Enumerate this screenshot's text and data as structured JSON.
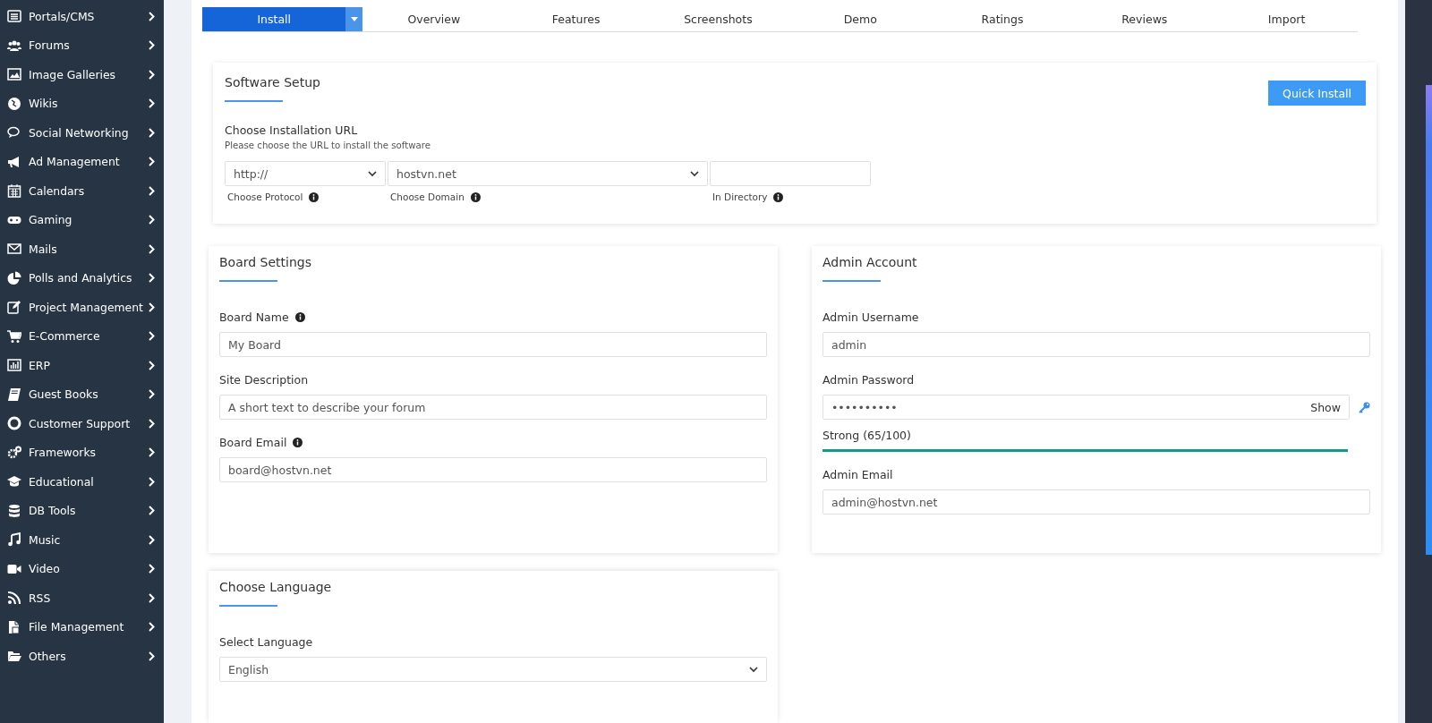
{
  "sidebar": {
    "items": [
      {
        "label": "Portals/CMS"
      },
      {
        "label": "Forums"
      },
      {
        "label": "Image Galleries"
      },
      {
        "label": "Wikis"
      },
      {
        "label": "Social Networking"
      },
      {
        "label": "Ad Management"
      },
      {
        "label": "Calendars"
      },
      {
        "label": "Gaming"
      },
      {
        "label": "Mails"
      },
      {
        "label": "Polls and Analytics"
      },
      {
        "label": "Project Management"
      },
      {
        "label": "E-Commerce"
      },
      {
        "label": "ERP"
      },
      {
        "label": "Guest Books"
      },
      {
        "label": "Customer Support"
      },
      {
        "label": "Frameworks"
      },
      {
        "label": "Educational"
      },
      {
        "label": "DB Tools"
      },
      {
        "label": "Music"
      },
      {
        "label": "Video"
      },
      {
        "label": "RSS"
      },
      {
        "label": "File Management"
      },
      {
        "label": "Others"
      }
    ]
  },
  "tabs": [
    {
      "label": "Install",
      "selected": true,
      "dropdown": true
    },
    {
      "label": "Overview",
      "selected": false,
      "dropdown": false
    },
    {
      "label": "Features",
      "selected": false,
      "dropdown": false
    },
    {
      "label": "Screenshots",
      "selected": false,
      "dropdown": false
    },
    {
      "label": "Demo",
      "selected": false,
      "dropdown": false
    },
    {
      "label": "Ratings",
      "selected": false,
      "dropdown": false
    },
    {
      "label": "Reviews",
      "selected": false,
      "dropdown": false
    },
    {
      "label": "Import",
      "selected": false,
      "dropdown": false
    }
  ],
  "software_setup": {
    "title": "Software Setup",
    "button": "Quick Install",
    "section_label": "Choose Installation URL",
    "hint": "Please choose the URL to install the software",
    "fields": [
      {
        "kind": "select",
        "value": "http://",
        "caption": "Choose Protocol"
      },
      {
        "kind": "select",
        "value": "hostvn.net",
        "caption": "Choose Domain"
      },
      {
        "kind": "text",
        "caption": "In Directory"
      }
    ]
  },
  "board_settings": {
    "title": "Board Settings",
    "fields": [
      {
        "label": "Board Name",
        "info": true,
        "kind": "text",
        "value": "My Board"
      },
      {
        "label": "Site Description",
        "info": false,
        "kind": "text",
        "value": "A short text to describe your forum"
      },
      {
        "label": "Board Email",
        "info": true,
        "kind": "text",
        "value": "board@hostvn.net"
      }
    ]
  },
  "admin_account": {
    "title": "Admin Account",
    "fields": [
      {
        "label": "Admin Username",
        "info": false,
        "kind": "text",
        "value": "admin"
      },
      {
        "label": "Admin Password",
        "info": false,
        "kind": "password",
        "value": "••••••••••",
        "toggle": "Show",
        "strength": "Strong (65/100)",
        "level": 1
      },
      {
        "label": "Admin Email",
        "info": false,
        "kind": "text",
        "value": "admin@hostvn.net"
      }
    ]
  },
  "language": {
    "title": "Choose Language",
    "fields": [
      {
        "label": "Select Language",
        "info": false,
        "kind": "select",
        "value": "English"
      }
    ]
  }
}
